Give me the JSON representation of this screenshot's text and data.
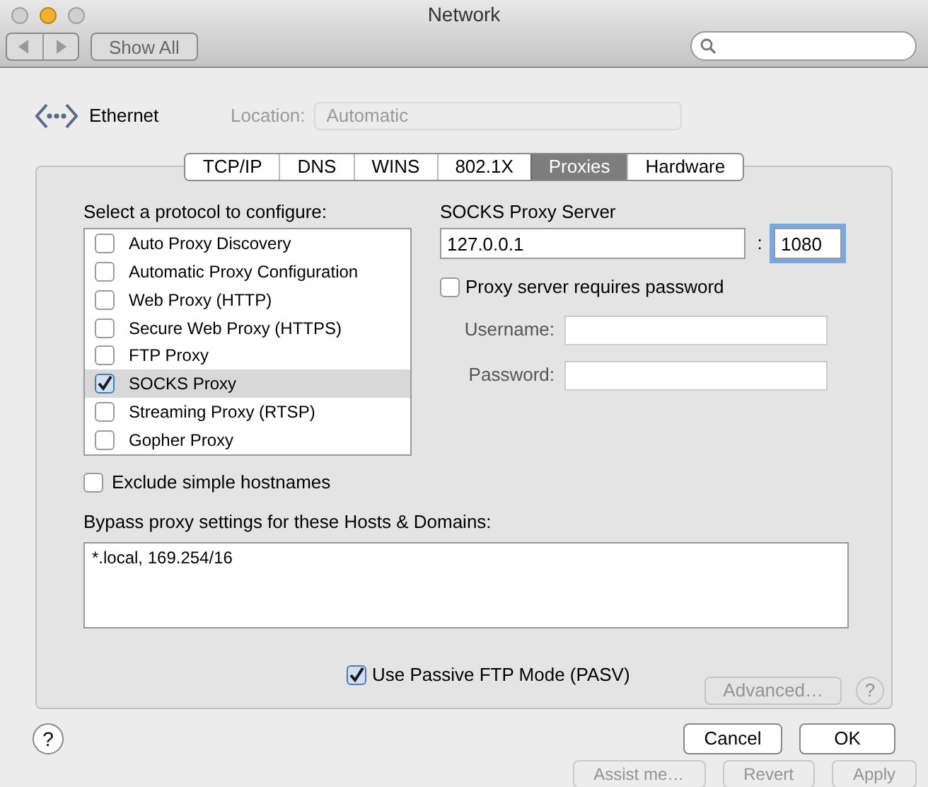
{
  "window": {
    "title": "Network"
  },
  "toolbar": {
    "show_all": "Show All"
  },
  "header": {
    "service": "Ethernet",
    "location_label": "Location:",
    "location_value": "Automatic"
  },
  "tabs": [
    {
      "label": "TCP/IP",
      "selected": false
    },
    {
      "label": "DNS",
      "selected": false
    },
    {
      "label": "WINS",
      "selected": false
    },
    {
      "label": "802.1X",
      "selected": false
    },
    {
      "label": "Proxies",
      "selected": true
    },
    {
      "label": "Hardware",
      "selected": false
    }
  ],
  "protocols_label": "Select a protocol to configure:",
  "protocols": [
    {
      "label": "Auto Proxy Discovery",
      "checked": false,
      "selected": false
    },
    {
      "label": "Automatic Proxy Configuration",
      "checked": false,
      "selected": false
    },
    {
      "label": "Web Proxy (HTTP)",
      "checked": false,
      "selected": false
    },
    {
      "label": "Secure Web Proxy (HTTPS)",
      "checked": false,
      "selected": false
    },
    {
      "label": "FTP Proxy",
      "checked": false,
      "selected": false
    },
    {
      "label": "SOCKS Proxy",
      "checked": true,
      "selected": true
    },
    {
      "label": "Streaming Proxy (RTSP)",
      "checked": false,
      "selected": false
    },
    {
      "label": "Gopher Proxy",
      "checked": false,
      "selected": false
    }
  ],
  "exclude_simple_hostnames": {
    "label": "Exclude simple hostnames",
    "checked": false
  },
  "bypass": {
    "label": "Bypass proxy settings for these Hosts & Domains:",
    "value": "*.local, 169.254/16"
  },
  "passive_ftp": {
    "label": "Use Passive FTP Mode (PASV)",
    "checked": true
  },
  "socks": {
    "label": "SOCKS Proxy Server",
    "host": "127.0.0.1",
    "separator": ":",
    "port": "1080",
    "password_required": {
      "label": "Proxy server requires password",
      "checked": false
    },
    "username_label": "Username:",
    "password_label": "Password:"
  },
  "background": {
    "advanced": "Advanced…",
    "help": "?",
    "buttons": [
      "Assist me…",
      "Revert",
      "Apply"
    ]
  },
  "footer": {
    "help": "?",
    "cancel": "Cancel",
    "ok": "OK"
  }
}
